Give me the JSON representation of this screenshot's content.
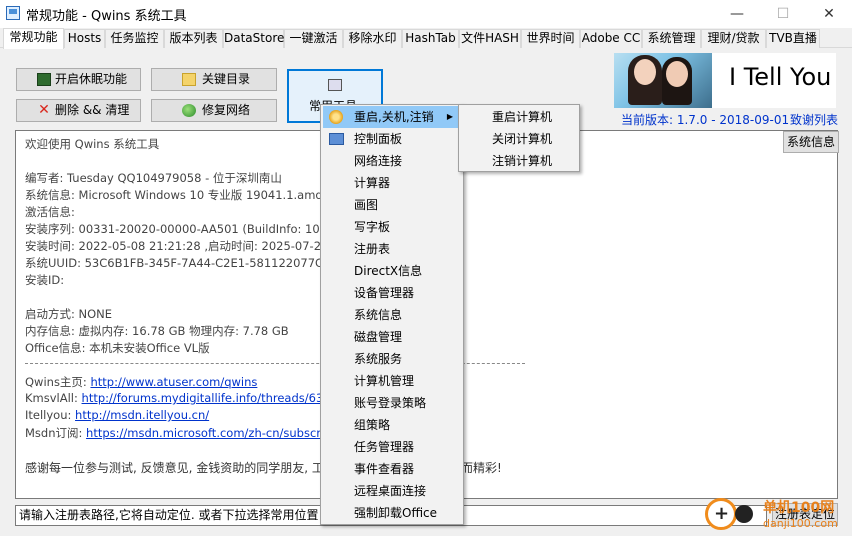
{
  "window": {
    "title": "常规功能 - Qwins 系统工具",
    "minimize": "—",
    "maximize": "☐",
    "close": "✕"
  },
  "tabs": [
    "常规功能",
    "Hosts",
    "任务监控",
    "版本列表",
    "DataStore",
    "一键激活",
    "移除水印",
    "HashTab",
    "文件HASH",
    "世界时间",
    "Adobe CC",
    "系统管理",
    "理财/贷款",
    "TVB直播"
  ],
  "buttons": {
    "sleep": "开启休眠功能",
    "key_dirs": "关键目录",
    "delete_clean": "删除 && 清理",
    "repair_net": "修复网络",
    "common_tools": "常用工具"
  },
  "banner": {
    "text": "I Tell You",
    "version": "当前版本: 1.7.0 - 2018-09-01",
    "thanks": "致谢列表",
    "sysinfo_button": "系统信息"
  },
  "info": {
    "welcome": "欢迎使用 Qwins 系统工具",
    "author": "编写者: Tuesday QQ104979058 - 位于深圳南山",
    "sysinfo": "系统信息: Microsoft Windows 10 专业版 19041.1.amd64fre.",
    "activation": "激活信息:",
    "serial": "安装序列: 00331-20020-00000-AA501 (BuildInfo: 10.0.1904",
    "install_time": "安装时间: 2022-05-08 21:21:28 ,启动时间: 2025-07-25 07:2",
    "uuid": "系统UUID: 53C6B1FB-345F-7A44-C2E1-581122077C09",
    "install_id": "安装ID:",
    "boot": "启动方式: NONE",
    "memory": "内存信息: 虚拟内存: 16.78 GB 物理内存: 7.78 GB",
    "office": "Office信息: 本机未安装Office VL版",
    "home_label": "Qwins主页:",
    "home_url": "http://www.atuser.com/qwins",
    "kms_label": "KmsvlAll:",
    "kms_url": "http://forums.mydigitallife.info/threads/63471-KMS",
    "itellyou_label": "Itellyou:",
    "itellyou_url": "http://msdn.itellyou.cn/",
    "msdn_label": "Msdn订阅:",
    "msdn_url": "https://msdn.microsoft.com/zh-cn/subscriptions/d",
    "thanks_line": "感谢每一位参与测试, 反馈意见, 金钱资助的同学朋友, 工",
    "thanks_tail": "而精彩!"
  },
  "path_input": {
    "placeholder": "请输入注册表路径,它将自动定位. 或者下拉选择常用位置"
  },
  "locate_button": "注册表定位",
  "context_menu": [
    "重启,关机,注销",
    "控制面板",
    "网络连接",
    "计算器",
    "画图",
    "写字板",
    "注册表",
    "DirectX信息",
    "设备管理器",
    "系统信息",
    "磁盘管理",
    "系统服务",
    "计算机管理",
    "账号登录策略",
    "组策略",
    "任务管理器",
    "事件查看器",
    "远程桌面连接",
    "强制卸载Office"
  ],
  "submenu": [
    "重启计算机",
    "关闭计算机",
    "注销计算机"
  ],
  "watermark": {
    "site": "单机100网",
    "domain": "danji100.com"
  }
}
